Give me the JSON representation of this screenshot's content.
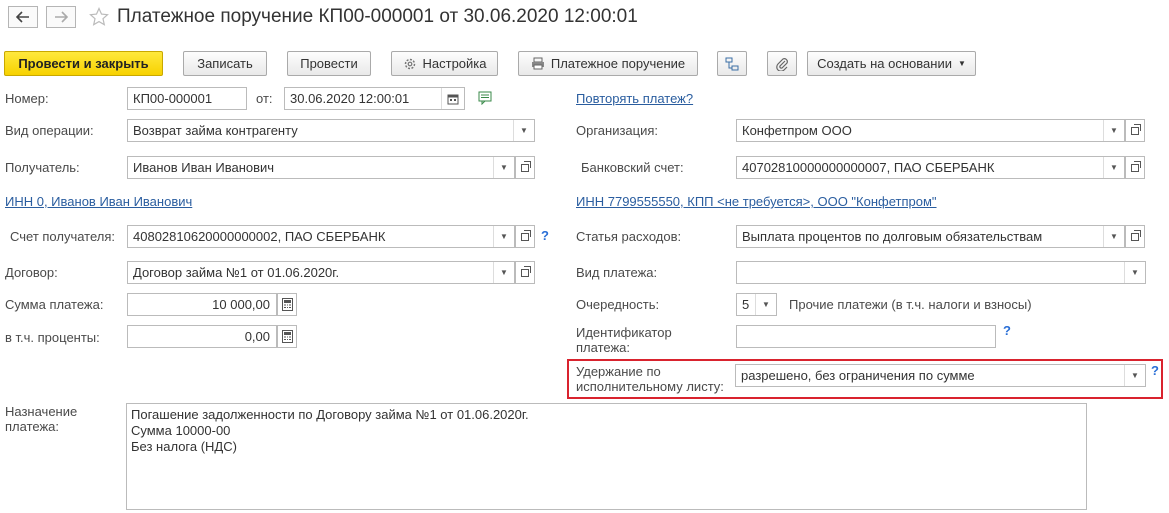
{
  "title": "Платежное поручение КП00-000001 от 30.06.2020 12:00:01",
  "toolbar": {
    "post_close": "Провести и закрыть",
    "save": "Записать",
    "post": "Провести",
    "settings": "Настройка",
    "print": "Платежное поручение",
    "create_based": "Создать на основании"
  },
  "left": {
    "number_label": "Номер:",
    "number_value": "КП00-000001",
    "date_label": "от:",
    "date_value": "30.06.2020 12:00:01",
    "operation_label": "Вид операции:",
    "operation_value": "Возврат займа контрагенту",
    "recipient_label": "Получатель:",
    "recipient_value": "Иванов Иван Иванович",
    "inn_link": "ИНН 0, Иванов Иван Иванович",
    "account_label": "Счет получателя:",
    "account_value": "40802810620000000002, ПАО СБЕРБАНК",
    "contract_label": "Договор:",
    "contract_value": "Договор займа №1 от 01.06.2020г.",
    "sum_label": "Сумма платежа:",
    "sum_value": "10 000,00",
    "interest_label": "в т.ч. проценты:",
    "interest_value": "0,00",
    "purpose_label": "Назначение платежа:",
    "purpose_lines": [
      "Погашение задолженности по Договору займа №1 от 01.06.2020г.",
      "Сумма 10000-00",
      "Без налога (НДС)"
    ]
  },
  "right": {
    "repeat_link": "Повторять платеж?",
    "org_label": "Организация:",
    "org_value": "Конфетпром ООО",
    "bank_label": "Банковский счет:",
    "bank_value": "40702810000000000007, ПАО СБЕРБАНК",
    "inn_link": "ИНН 7799555550, КПП <не требуется>, ООО \"Конфетпром\"",
    "expense_label": "Статья расходов:",
    "expense_value": "Выплата процентов по долговым обязательствам",
    "paytype_label": "Вид платежа:",
    "paytype_value": "",
    "priority_label": "Очередность:",
    "priority_value": "5",
    "priority_desc": "Прочие платежи (в т.ч. налоги и взносы)",
    "identifier_label": "Идентификатор платежа:",
    "identifier_value": "",
    "withhold_label": "Удержание по исполнительному листу:",
    "withhold_value": "разрешено, без ограничения по сумме"
  },
  "question_mark": "?",
  "icons": {
    "back": "arrow-left-icon",
    "forward": "arrow-right-icon",
    "favorite": "star-icon",
    "settings": "gear-icon",
    "print": "printer-icon",
    "structure": "document-structure-icon",
    "attach": "paperclip-icon",
    "calendar": "calendar-icon",
    "calculator": "calculator-icon",
    "open": "open-form-icon"
  },
  "colors": {
    "primary_button": "#f7d200",
    "link": "#2a5d9f",
    "highlight_border": "#d9232e",
    "help": "#2a6fd6"
  }
}
